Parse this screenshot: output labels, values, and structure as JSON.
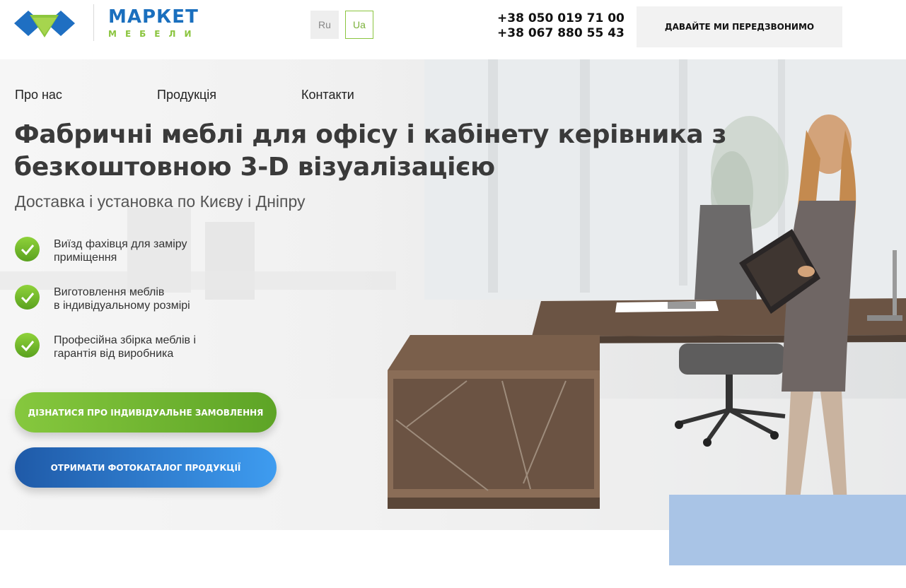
{
  "header": {
    "logo": {
      "title": "МАРКЕТ",
      "subtitle": "МЕБЕЛИ"
    },
    "languages": [
      "Ru",
      "Ua"
    ],
    "active_language": "Ua",
    "phones": [
      "+38 050 019 71 00",
      "+38 067 880 55 43"
    ],
    "callback_label": "ДАВАЙТЕ МИ ПЕРЕДЗВОНИМО"
  },
  "nav": [
    "Про нас",
    "Продукція",
    "Контакти"
  ],
  "hero": {
    "title_line1": "Фабричні меблі для офісу і кабінету керівника з",
    "title_line2": "безкоштовною 3-D візуалізацією",
    "subtitle": "Доставка і установка по Києву і Дніпру",
    "features": [
      {
        "line1": "Виїзд фахівця для заміру",
        "line2": "приміщення"
      },
      {
        "line1": "Виготовлення меблів",
        "line2": "в індивідуальному розмірі"
      },
      {
        "line1": "Професійна збірка меблів і",
        "line2": "гарантія від виробника"
      }
    ],
    "primary_button": "ДІЗНАТИСЯ ПРО ІНДИВІДУАЛЬНЕ ЗАМОВЛЕННЯ",
    "secondary_button": "ОТРИМАТИ ФОТОКАТАЛОГ ПРОДУКЦІЇ"
  },
  "colors": {
    "brand_blue": "#1a6fbe",
    "brand_green": "#8bc53f",
    "button_green": "#6db52e",
    "button_blue": "#2a7ad6"
  }
}
